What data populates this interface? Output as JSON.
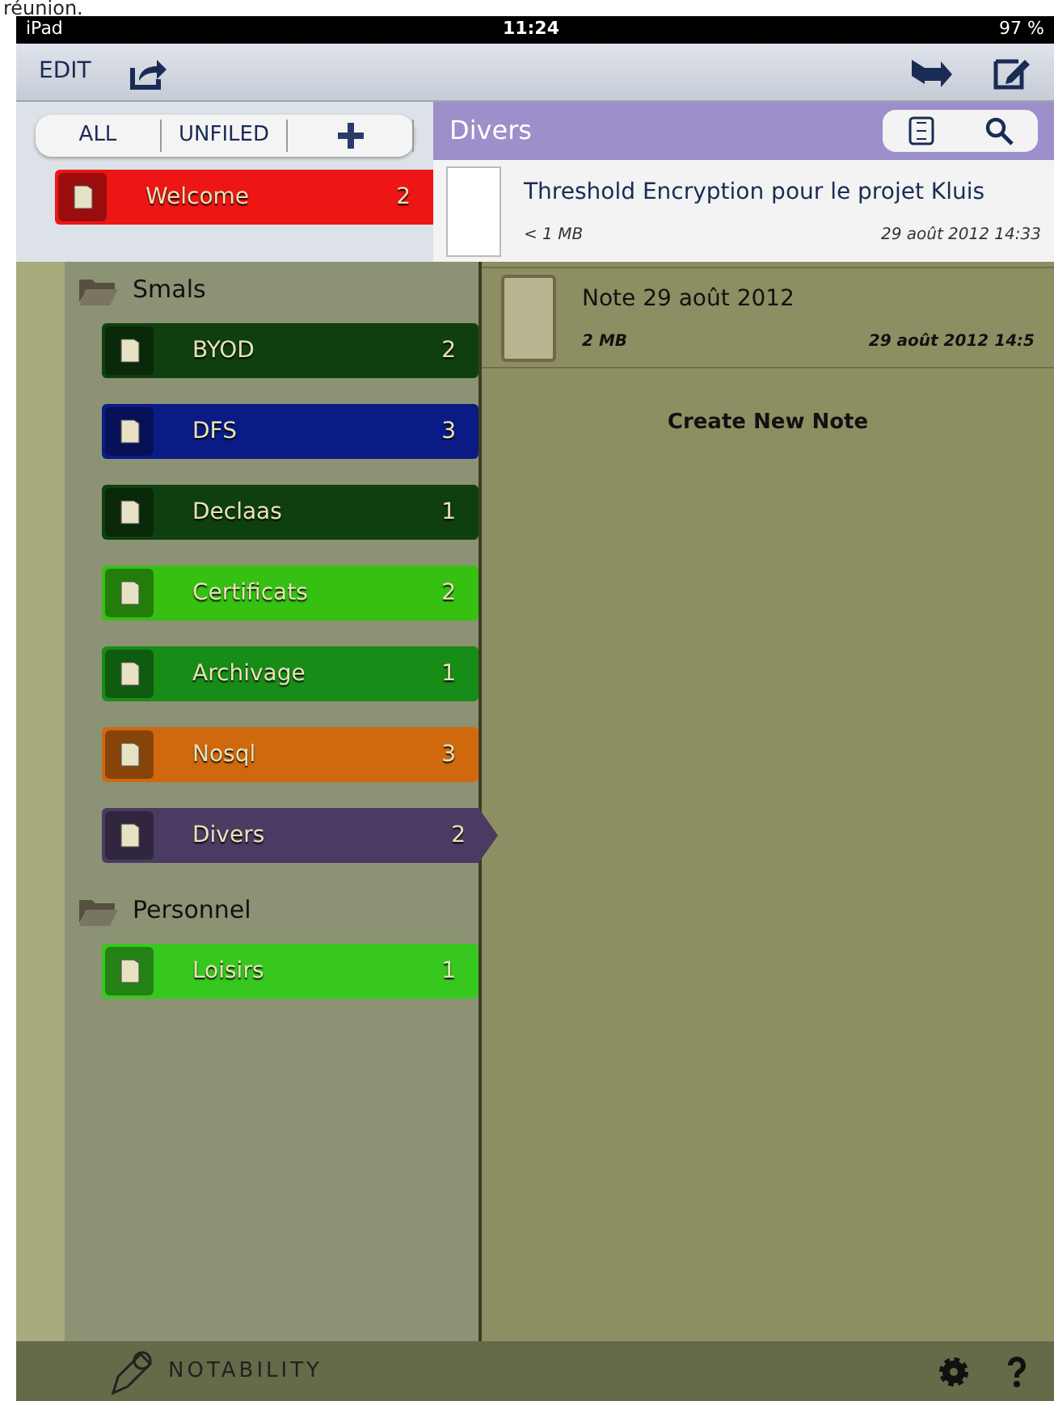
{
  "caption": "réunion.",
  "status_bar": {
    "device": "iPad",
    "time": "11:24",
    "battery": "97 %"
  },
  "toolbar": {
    "edit": "EDIT"
  },
  "filter_tabs": [
    {
      "label": "ALL"
    },
    {
      "label": "UNFILED"
    }
  ],
  "top_notebook": {
    "name": "Welcome",
    "count": "2",
    "color": "#ee1515",
    "selected": false
  },
  "list_header": {
    "title": "Divers"
  },
  "notes_top": [
    {
      "title": "Threshold Encryption pour le projet Kluis",
      "size": "< 1 MB",
      "date": "29 août 2012 14:33"
    }
  ],
  "folders": [
    {
      "name": "Smals",
      "notebooks": [
        {
          "name": "BYOD",
          "count": "2",
          "color": "#0f3f0f",
          "selected": false
        },
        {
          "name": "DFS",
          "count": "3",
          "color": "#0b1b86",
          "selected": false
        },
        {
          "name": "Declaas",
          "count": "1",
          "color": "#0f3f0f",
          "selected": false
        },
        {
          "name": "Certificats",
          "count": "2",
          "color": "#36c012",
          "selected": false
        },
        {
          "name": "Archivage",
          "count": "1",
          "color": "#178c17",
          "selected": false
        },
        {
          "name": "Nosql",
          "count": "3",
          "color": "#d0690e",
          "selected": false
        },
        {
          "name": "Divers",
          "count": "2",
          "color": "#4a3b62",
          "selected": true
        }
      ]
    },
    {
      "name": "Personnel",
      "notebooks": [
        {
          "name": "Loisirs",
          "count": "1",
          "color": "#36c81e",
          "selected": false
        }
      ]
    }
  ],
  "notes": [
    {
      "title": "Note 29 août 2012",
      "size": "2 MB",
      "date": "29 août 2012 14:5"
    }
  ],
  "create_note": "Create New Note",
  "footer": {
    "logo": "NOTABILITY"
  }
}
